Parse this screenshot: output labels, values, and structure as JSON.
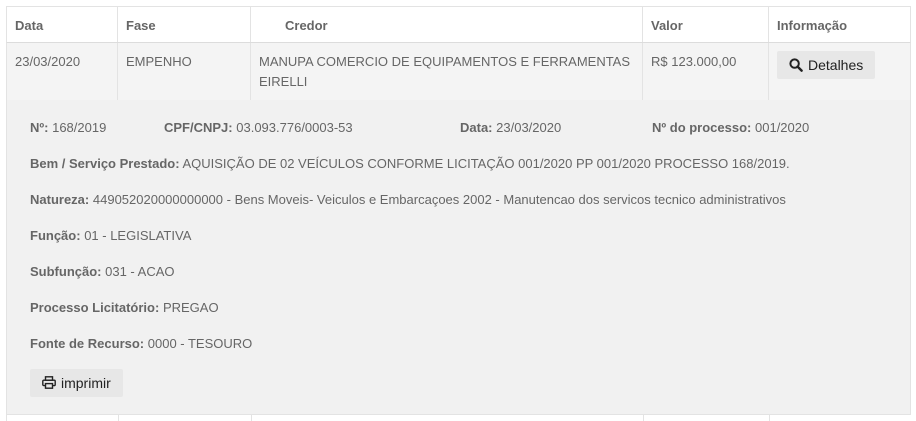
{
  "table": {
    "headers": [
      "Data",
      "Fase",
      "Credor",
      "Valor",
      "Informação"
    ],
    "row": {
      "data": "23/03/2020",
      "fase": "EMPENHO",
      "credor": "MANUPA COMERCIO DE EQUIPAMENTOS E FERRAMENTAS EIRELLI",
      "valor": "R$ 123.000,00",
      "details_label": "Detalhes",
      "details_icon": "search-icon"
    }
  },
  "detail": {
    "numero_label": "Nº:",
    "numero": "168/2019",
    "cpf_label": "CPF/CNPJ:",
    "cpf": "03.093.776/0003-53",
    "data_label": "Data:",
    "data": "23/03/2020",
    "processo_label": "Nº do processo:",
    "processo": "001/2020",
    "bem_label": "Bem / Serviço Prestado:",
    "bem": "AQUISIÇÃO DE 02 VEÍCULOS CONFORME LICITAÇÃO 001/2020 PP 001/2020 PROCESSO 168/2019.",
    "natureza_label": "Natureza:",
    "natureza": "449052020000000000 - Bens Moveis- Veiculos e Embarcaçoes 2002 - Manutencao dos servicos tecnico administrativos",
    "funcao_label": "Função:",
    "funcao": "01 - LEGISLATIVA",
    "subfuncao_label": "Subfunção:",
    "subfuncao": "031 - ACAO",
    "licitatorio_label": "Processo Licitatório:",
    "licitatorio": "PREGAO",
    "fonte_label": "Fonte de Recurso:",
    "fonte": "0000 - TESOURO",
    "print_label": "imprimir",
    "print_icon": "printer-icon"
  }
}
